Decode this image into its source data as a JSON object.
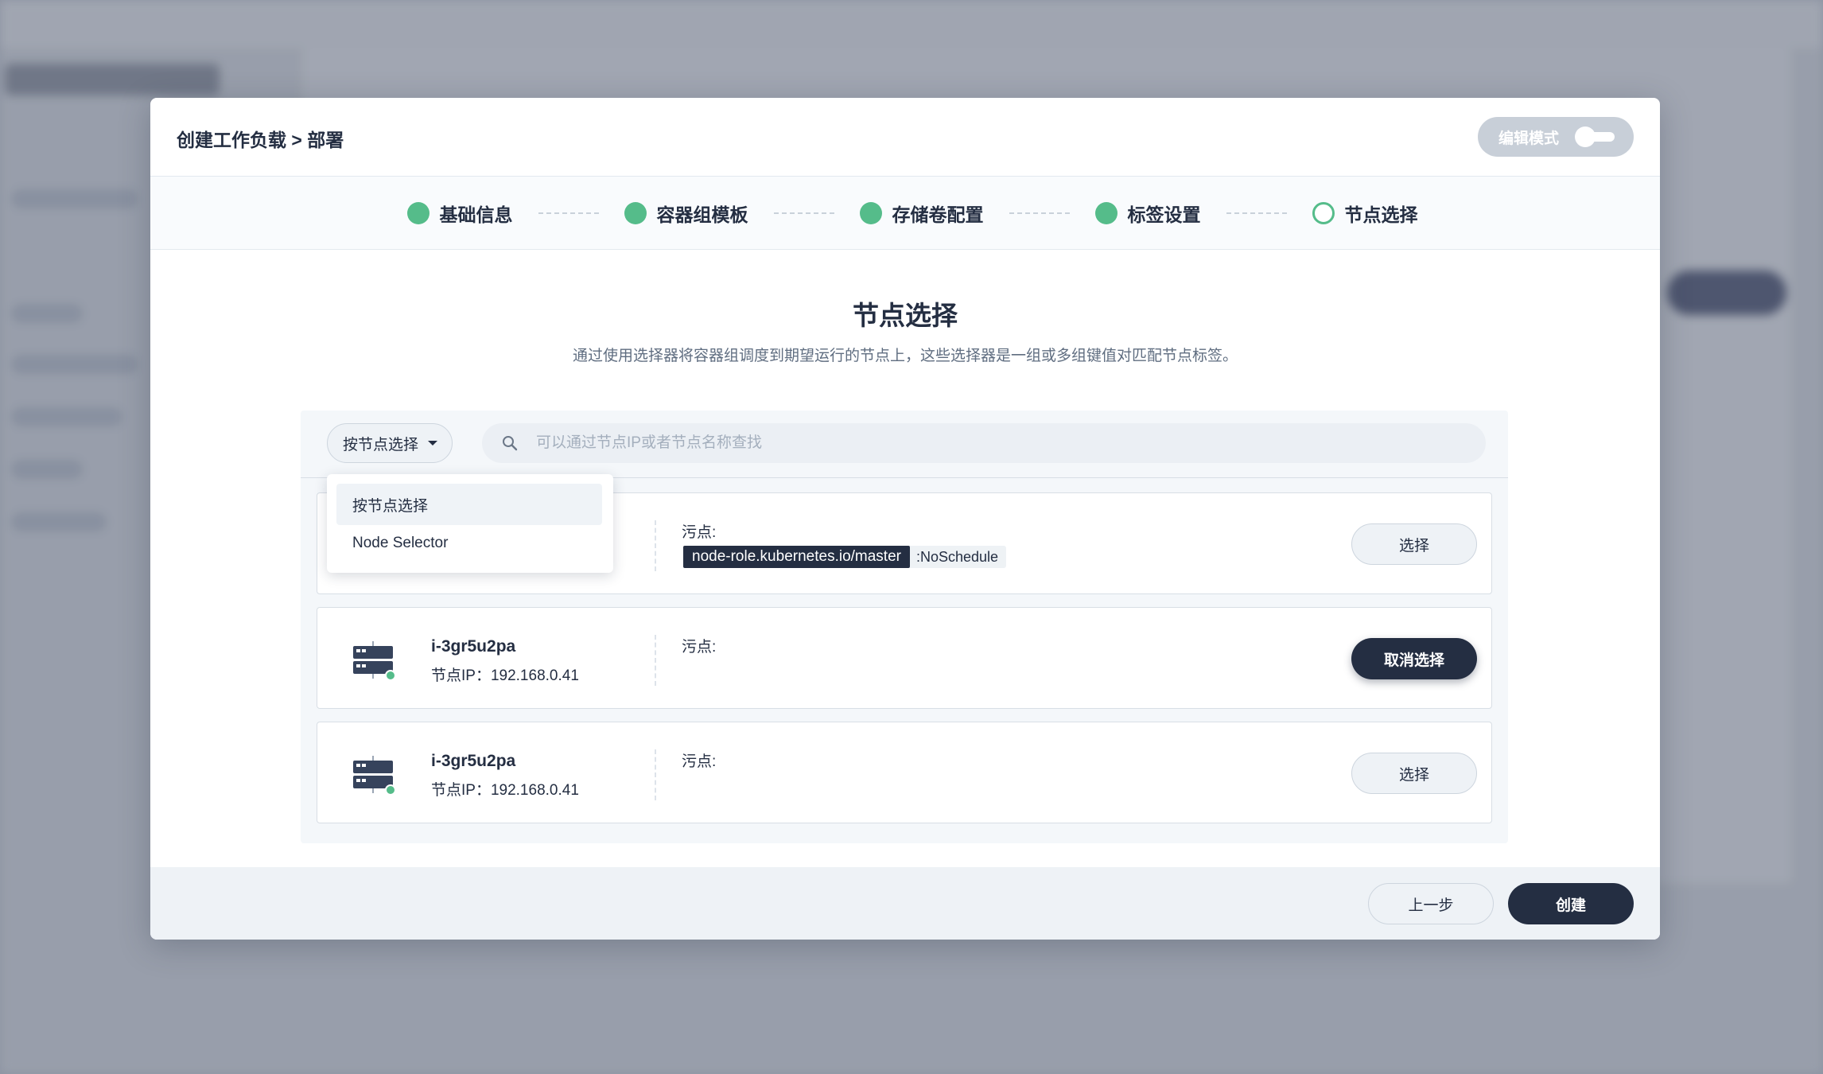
{
  "modal": {
    "title": "创建工作负载 > 部署",
    "edit_mode_label": "编辑模式",
    "edit_mode_on": false
  },
  "steps": [
    {
      "label": "基础信息",
      "state": "done"
    },
    {
      "label": "容器组模板",
      "state": "done"
    },
    {
      "label": "存储卷配置",
      "state": "done"
    },
    {
      "label": "标签设置",
      "state": "done"
    },
    {
      "label": "节点选择",
      "state": "current"
    }
  ],
  "section": {
    "title": "节点选择",
    "description": "通过使用选择器将容器组调度到期望运行的节点上，这些选择器是一组或多组键值对匹配节点标签。"
  },
  "toolbar": {
    "select_value": "按节点选择",
    "search_placeholder": "可以通过节点IP或者节点名称查找"
  },
  "dropdown": {
    "options": [
      "按节点选择",
      "Node Selector"
    ],
    "selected_index": 0
  },
  "nodes": [
    {
      "taint_label": "污点:",
      "taint_key": "node-role.kubernetes.io/master",
      "taint_effect": ":NoSchedule",
      "action_label": "选择"
    },
    {
      "name": "i-3gr5u2pa",
      "ip": "节点IP：192.168.0.41",
      "taint_label": "污点:",
      "action_label": "取消选择"
    },
    {
      "name": "i-3gr5u2pa",
      "ip": "节点IP：192.168.0.41",
      "taint_label": "污点:",
      "action_label": "选择"
    }
  ],
  "footer": {
    "prev_label": "上一步",
    "create_label": "创建"
  },
  "colors": {
    "primary_dark": "#242e42",
    "success_green": "#55bc8a",
    "overlay": "#8c93a2"
  },
  "icons": [
    "search-icon",
    "server-node-icon",
    "chevron-down-icon"
  ]
}
